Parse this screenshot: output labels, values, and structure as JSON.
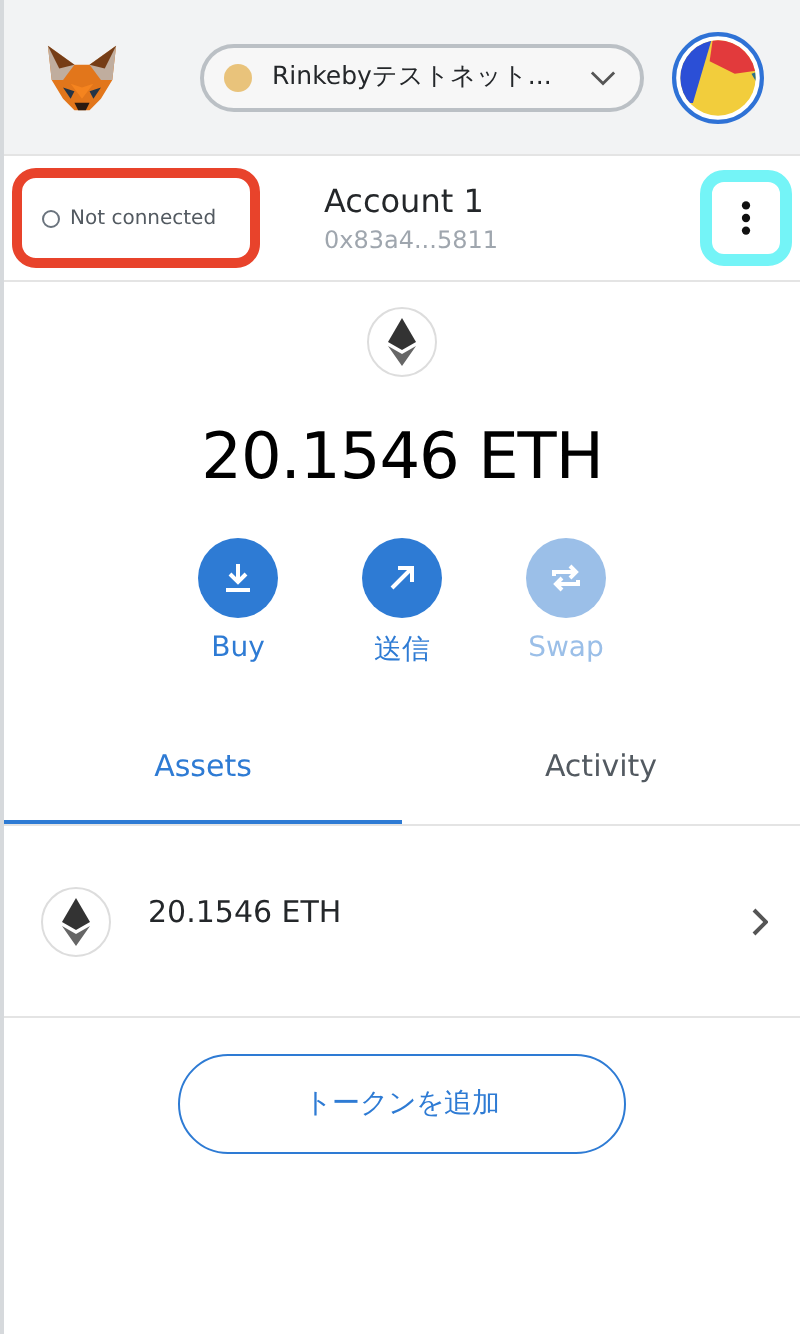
{
  "header": {
    "network": {
      "label": "Rinkebyテストネット...",
      "color": "#e9c37b"
    }
  },
  "account": {
    "status": {
      "label": "Not connected",
      "connected": false,
      "highlighted": true
    },
    "name": "Account 1",
    "address": "0x83a4...5811",
    "menu_highlighted": true
  },
  "balance": "20.1546 ETH",
  "actions": [
    {
      "kind": "buy",
      "label": "Buy",
      "disabled": false
    },
    {
      "kind": "send",
      "label": "送信",
      "disabled": false
    },
    {
      "kind": "swap",
      "label": "Swap",
      "disabled": true
    }
  ],
  "tabs": [
    {
      "label": "Assets",
      "selected": true
    },
    {
      "label": "Activity",
      "selected": false
    }
  ],
  "assets": [
    {
      "amount": "20.1546 ETH"
    }
  ],
  "add_token_button": "トークンを追加"
}
